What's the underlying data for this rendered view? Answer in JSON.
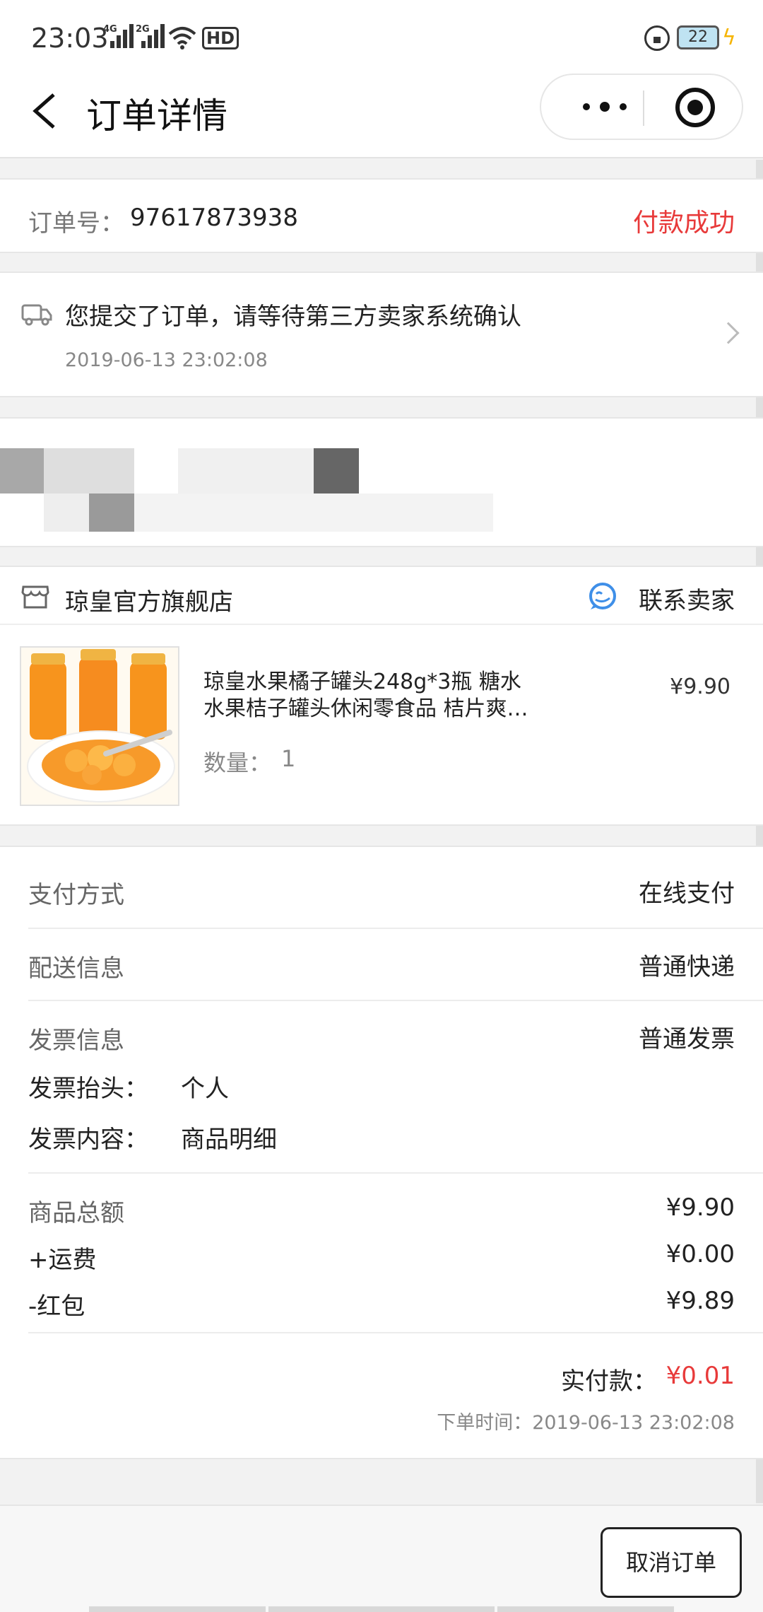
{
  "status_bar": {
    "time": "23:03",
    "net1": "4G",
    "net2": "2G",
    "hd": "HD",
    "battery": "22"
  },
  "nav": {
    "title": "订单详情"
  },
  "order": {
    "number_label": "订单号：",
    "number": "97617873938",
    "status": "付款成功"
  },
  "logistics": {
    "message": "您提交了订单，请等待第三方卖家系统确认",
    "time": "2019-06-13 23:02:08"
  },
  "shop": {
    "name": "琼皇官方旗舰店",
    "contact_label": "联系卖家"
  },
  "product": {
    "title_line1": "琼皇水果橘子罐头248g*3瓶 糖水",
    "title_line2": "水果桔子罐头休闲零食品 桔片爽…",
    "price": "¥9.90",
    "qty_label": "数量：",
    "qty": "1"
  },
  "info": {
    "payment_label": "支付方式",
    "payment_value": "在线支付",
    "delivery_label": "配送信息",
    "delivery_value": "普通快递",
    "invoice_label": "发票信息",
    "invoice_value": "普通发票",
    "invoice_title_label": "发票抬头：",
    "invoice_title_value": "个人",
    "invoice_content_label": "发票内容：",
    "invoice_content_value": "商品明细"
  },
  "totals": {
    "goods_label": "商品总额",
    "goods_value": "¥9.90",
    "shipping_label": "+运费",
    "shipping_value": "¥0.00",
    "redpacket_label": "-红包",
    "redpacket_value": "¥9.89",
    "paid_label": "实付款：",
    "paid_value": "¥0.01",
    "order_time": "下单时间：2019-06-13 23:02:08"
  },
  "actions": {
    "cancel": "取消订单"
  },
  "colors": {
    "accent_red": "#e83a3a",
    "contact_blue": "#3f8fe8"
  }
}
